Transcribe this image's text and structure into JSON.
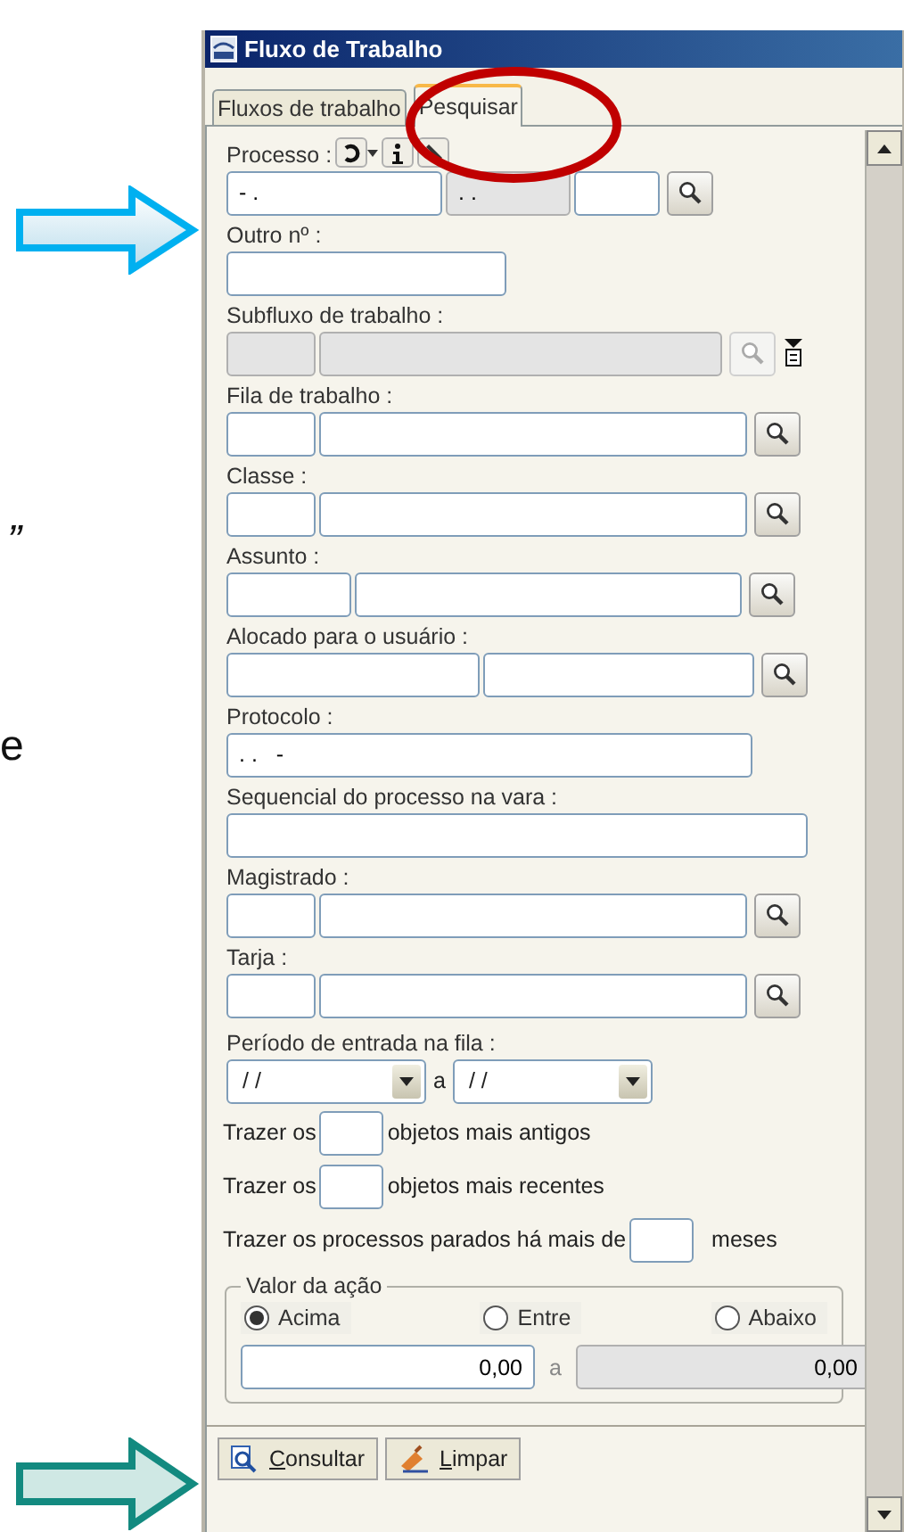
{
  "slide_text": [
    {
      "text": "”"
    },
    {
      "text": "e"
    }
  ],
  "window": {
    "title": "Fluxo de Trabalho"
  },
  "tabs": [
    {
      "label": "Fluxos de trabalho",
      "selected": false
    },
    {
      "label": "Pesquisar",
      "selected": true
    }
  ],
  "form": [
    {
      "kind": "number",
      "label": "Processo :",
      "inputs": [
        {
          "value": "- .",
          "disabled": false
        },
        {
          "value": ". .",
          "disabled": true
        },
        {
          "disabled": false
        }
      ]
    },
    {
      "kind": "text",
      "label": "Outro nº :",
      "inputs": [
        {
          "disabled": false
        }
      ]
    },
    {
      "kind": "subflow",
      "label": "Subfluxo de trabalho :",
      "inputs": [
        {
          "disabled": true
        },
        {
          "disabled": true
        }
      ]
    },
    {
      "kind": "lookup",
      "label": "Fila de trabalho :",
      "inputs": [
        {
          "disabled": false
        },
        {
          "disabled": false
        }
      ]
    },
    {
      "kind": "lookup",
      "label": "Classe :",
      "inputs": [
        {
          "disabled": false
        },
        {
          "disabled": false
        }
      ]
    },
    {
      "kind": "lookup",
      "label": "Assunto :",
      "inputs": [
        {
          "disabled": false
        },
        {
          "disabled": false
        }
      ]
    },
    {
      "kind": "split",
      "label": "Alocado para o usuário :",
      "inputs": [
        {
          "disabled": false
        },
        {
          "disabled": false
        }
      ]
    },
    {
      "kind": "wide",
      "label": "Protocolo :",
      "inputs": [
        {
          "value": ". .   -",
          "disabled": false
        }
      ]
    },
    {
      "kind": "full",
      "label": "Sequencial do processo na vara :",
      "inputs": [
        {
          "disabled": false
        }
      ]
    },
    {
      "kind": "lookup",
      "label": "Magistrado :",
      "inputs": [
        {
          "disabled": false
        },
        {
          "disabled": false
        }
      ]
    },
    {
      "kind": "lookup",
      "label": "Tarja :",
      "inputs": [
        {
          "disabled": false
        },
        {
          "disabled": false
        }
      ]
    }
  ],
  "period": {
    "label": "Período de entrada na fila :",
    "from": "/ /",
    "separator": "a",
    "to": "/ /"
  },
  "bring_rows": [
    {
      "before": "Trazer os",
      "after": "objetos mais antigos"
    },
    {
      "before": "Trazer os",
      "after": "objetos mais recentes"
    },
    {
      "before": "Trazer os processos parados há mais de",
      "after": "meses"
    }
  ],
  "value_group": {
    "title": "Valor da ação",
    "options": [
      {
        "label": "Acima",
        "selected": true
      },
      {
        "label": "Entre",
        "selected": false
      },
      {
        "label": "Abaixo",
        "selected": false
      }
    ],
    "from": {
      "value": "0,00",
      "disabled": false
    },
    "separator": "a",
    "to": {
      "value": "0,00",
      "disabled": true
    }
  },
  "buttons": [
    {
      "kind": "search",
      "label": "Consultar"
    },
    {
      "kind": "clear",
      "label": "Limpar"
    }
  ]
}
